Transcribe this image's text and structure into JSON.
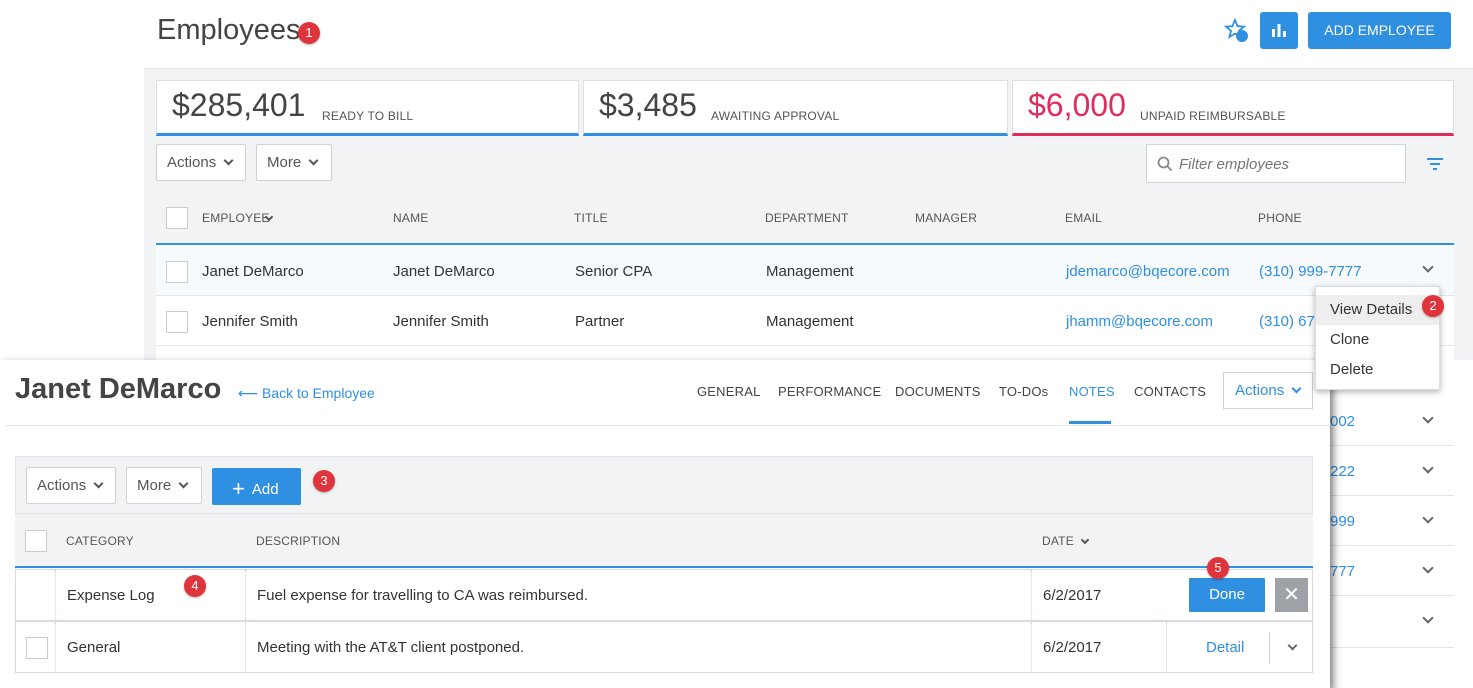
{
  "employees_page": {
    "title": "Employees",
    "badge": "1",
    "add_button": "ADD EMPLOYEE",
    "stats": [
      {
        "amount": "$285,401",
        "label": "READY TO BILL"
      },
      {
        "amount": "$3,485",
        "label": "AWAITING APPROVAL"
      },
      {
        "amount": "$6,000",
        "label": "UNPAID REIMBURSABLE"
      }
    ],
    "toolbar": {
      "actions": "Actions",
      "more": "More",
      "filter_placeholder": "Filter employees"
    },
    "columns": [
      "EMPLOYEE",
      "NAME",
      "TITLE",
      "DEPARTMENT",
      "MANAGER",
      "EMAIL",
      "PHONE"
    ],
    "rows": [
      {
        "employee": "Janet DeMarco",
        "name": "Janet DeMarco",
        "title": "Senior CPA",
        "department": "Management",
        "manager": "",
        "email": "jdemarco@bqecore.com",
        "phone": "(310) 999-7777"
      },
      {
        "employee": "Jennifer Smith",
        "name": "Jennifer Smith",
        "title": "Partner",
        "department": "Management",
        "manager": "",
        "email": "jhamm@bqecore.com",
        "phone": "(310) 678"
      }
    ],
    "partial_phones": [
      "002",
      "222",
      "999",
      "777"
    ],
    "context_menu": {
      "items": [
        "View Details",
        "Clone",
        "Delete"
      ],
      "badge": "2"
    },
    "accent_color": "#2f8fe0",
    "alert_color": "#e02b5b"
  },
  "notes_view": {
    "title": "Janet DeMarco",
    "back_link": "Back to Employee",
    "tabs": [
      "GENERAL",
      "PERFORMANCE",
      "DOCUMENTS",
      "TO-DOs",
      "NOTES",
      "CONTACTS"
    ],
    "active_tab": "NOTES",
    "actions_menu": "Actions",
    "toolbar": {
      "actions": "Actions",
      "more": "More",
      "add": "Add",
      "badge": "3"
    },
    "columns": {
      "category": "CATEGORY",
      "description": "DESCRIPTION",
      "date": "DATE"
    },
    "rows": [
      {
        "category": "Expense Log",
        "description": "Fuel expense for travelling to CA was reimbursed.",
        "date": "6/2/2017",
        "badge": "4"
      },
      {
        "category": "General",
        "description": "Meeting with the AT&T client postponed.",
        "date": "6/2/2017"
      }
    ],
    "done_button": "Done",
    "done_badge": "5",
    "close_symbol": "✕",
    "detail_link": "Detail"
  }
}
